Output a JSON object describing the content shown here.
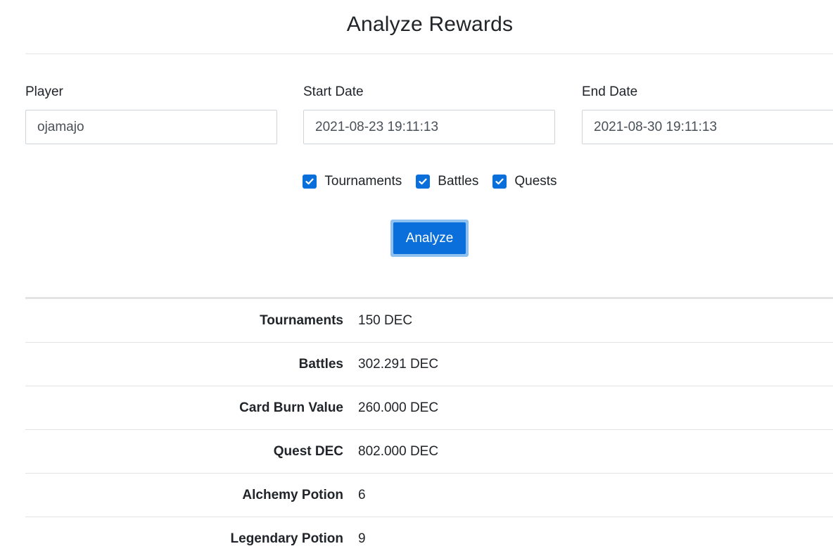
{
  "page": {
    "title": "Analyze Rewards"
  },
  "form": {
    "player": {
      "label": "Player",
      "value": "ojamajo"
    },
    "start_date": {
      "label": "Start Date",
      "value": "2021-08-23 19:11:13"
    },
    "end_date": {
      "label": "End Date",
      "value": "2021-08-30 19:11:13"
    },
    "checkboxes": [
      {
        "label": "Tournaments",
        "checked": true
      },
      {
        "label": "Battles",
        "checked": true
      },
      {
        "label": "Quests",
        "checked": true
      }
    ],
    "analyze_label": "Analyze"
  },
  "colors": {
    "accent": "#0a6fdb",
    "focus_ring": "#8fc1f0",
    "divider": "#e3e3e3"
  },
  "results": [
    {
      "label": "Tournaments",
      "value": "150 DEC"
    },
    {
      "label": "Battles",
      "value": "302.291 DEC"
    },
    {
      "label": "Card Burn Value",
      "value": "260.000 DEC"
    },
    {
      "label": "Quest DEC",
      "value": "802.000 DEC"
    },
    {
      "label": "Alchemy Potion",
      "value": "6"
    },
    {
      "label": "Legendary Potion",
      "value": "9"
    }
  ]
}
